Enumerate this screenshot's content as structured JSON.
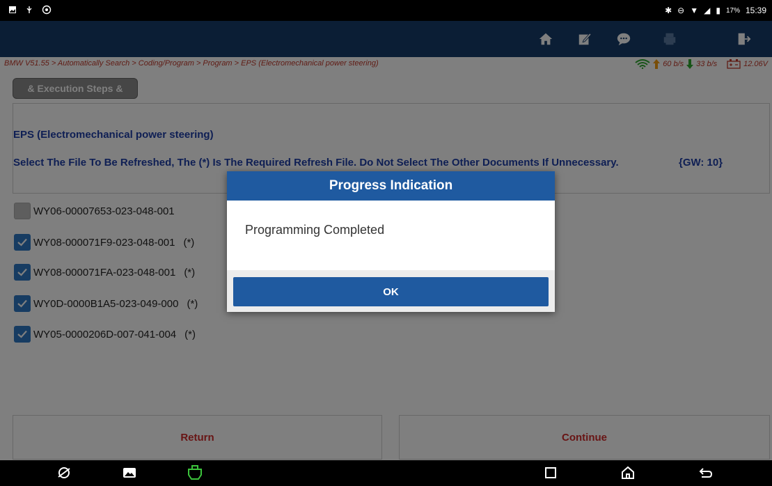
{
  "status_bar": {
    "battery": "17%",
    "time": "15:39"
  },
  "breadcrumb": "BMW V51.55 > Automatically Search > Coding/Program > Program > EPS (Electromechanical power steering)",
  "speed": {
    "up": "60 b/s",
    "down": "33 b/s",
    "voltage": "12.06V"
  },
  "steps_button": "& Execution Steps &",
  "info": {
    "title": "EPS (Electromechanical power steering)",
    "instruction": "Select The File To Be Refreshed, The (*) Is The Required Refresh File. Do Not Select The Other Documents If Unnecessary.",
    "gw": "{GW: 10}"
  },
  "files": [
    {
      "name": "WY06-00007653-023-048-001",
      "required": "",
      "checked": false
    },
    {
      "name": "WY08-000071F9-023-048-001",
      "required": "(*)",
      "checked": true
    },
    {
      "name": "WY08-000071FA-023-048-001",
      "required": "(*)",
      "checked": true
    },
    {
      "name": "WY0D-0000B1A5-023-049-000",
      "required": "(*)",
      "checked": true
    },
    {
      "name": "WY05-0000206D-007-041-004",
      "required": "(*)",
      "checked": true
    }
  ],
  "buttons": {
    "return": "Return",
    "continue": "Continue"
  },
  "dialog": {
    "title": "Progress Indication",
    "message": "Programming Completed",
    "ok": "OK"
  },
  "colors": {
    "nav": "#173c6a",
    "dialog_header": "#1f5aa0",
    "link_red": "#d12b2b",
    "info_blue": "#1f3fa8"
  }
}
